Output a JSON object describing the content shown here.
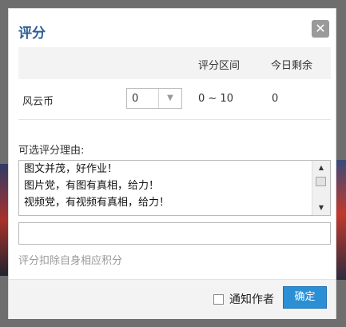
{
  "dialog": {
    "title": "评分",
    "close_icon": "close-icon"
  },
  "table": {
    "headers": [
      "评分区间",
      "今日剩余"
    ],
    "row": {
      "label": "风云币",
      "select_value": "0",
      "range": "0 ~ 10",
      "remaining": "0"
    }
  },
  "reasons": {
    "label": "可选评分理由:",
    "items": [
      "图文并茂，好作业！",
      "图片党，有图有真相，给力！",
      "视频党，有视频有真相，给力！"
    ],
    "input_value": ""
  },
  "note": "评分扣除自身相应积分",
  "footer": {
    "notify_label": "通知作者",
    "notify_checked": false,
    "confirm_label": "确定"
  },
  "colors": {
    "title": "#2b5e96",
    "confirm": "#2b8fd6"
  }
}
